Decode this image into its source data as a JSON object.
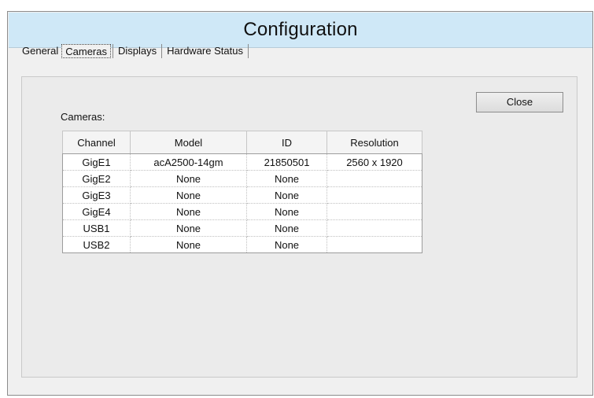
{
  "window": {
    "title": "Configuration"
  },
  "tabs": [
    {
      "label": "General",
      "active": false
    },
    {
      "label": "Cameras",
      "active": true
    },
    {
      "label": "Displays",
      "active": false
    },
    {
      "label": "Hardware Status",
      "active": false
    }
  ],
  "actions": {
    "close_label": "Close"
  },
  "cameras": {
    "label": "Cameras:",
    "columns": [
      "Channel",
      "Model",
      "ID",
      "Resolution"
    ],
    "rows": [
      [
        "GigE1",
        "acA2500-14gm",
        "21850501",
        "2560 x 1920"
      ],
      [
        "GigE2",
        "None",
        "None",
        ""
      ],
      [
        "GigE3",
        "None",
        "None",
        ""
      ],
      [
        "GigE4",
        "None",
        "None",
        ""
      ],
      [
        "USB1",
        "None",
        "None",
        ""
      ],
      [
        "USB2",
        "None",
        "None",
        ""
      ]
    ]
  }
}
